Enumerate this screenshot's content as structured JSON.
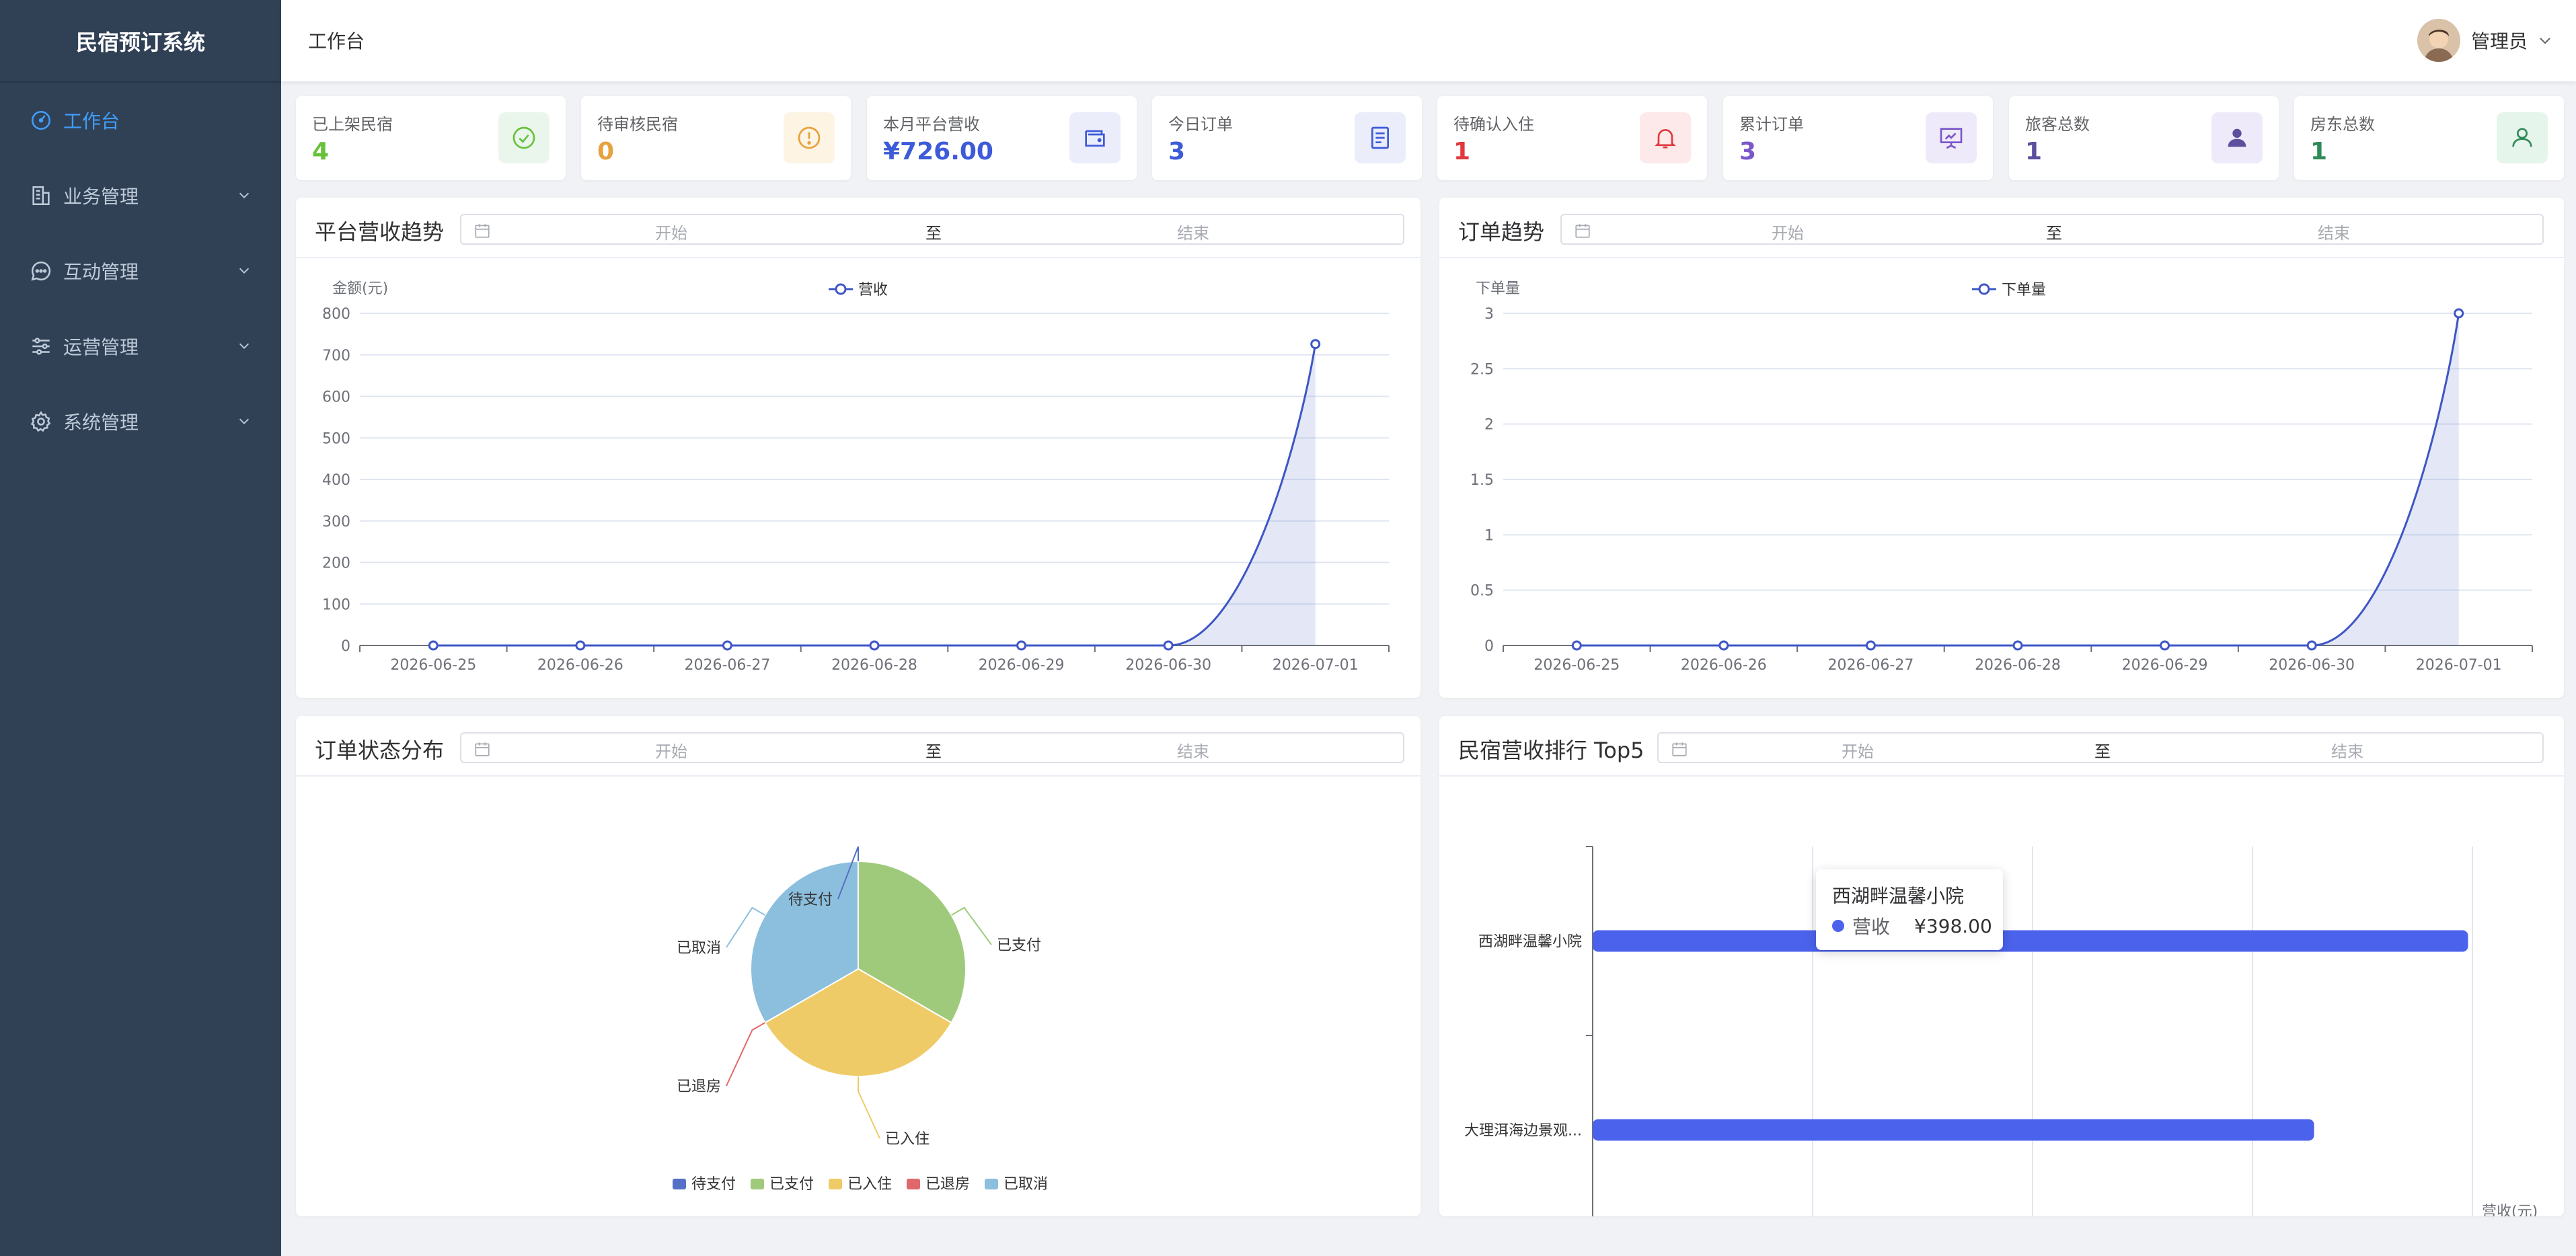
{
  "app": {
    "title": "民宿预订系统"
  },
  "sidebar": {
    "items": [
      {
        "label": "工作台",
        "icon": "dashboard-icon",
        "active": true,
        "expandable": false
      },
      {
        "label": "业务管理",
        "icon": "building-icon",
        "active": false,
        "expandable": true
      },
      {
        "label": "互动管理",
        "icon": "chat-icon",
        "active": false,
        "expandable": true
      },
      {
        "label": "运营管理",
        "icon": "sliders-icon",
        "active": false,
        "expandable": true
      },
      {
        "label": "系统管理",
        "icon": "gear-icon",
        "active": false,
        "expandable": true
      }
    ]
  },
  "header": {
    "breadcrumb": "工作台",
    "user_name": "管理员"
  },
  "stats": [
    {
      "label": "已上架民宿",
      "value": "4",
      "color": "#67c23a",
      "icon": "check-circle-icon",
      "bg": "#eaf6ec"
    },
    {
      "label": "待审核民宿",
      "value": "0",
      "color": "#e6a23c",
      "icon": "warning-circle-icon",
      "bg": "#fdf4e4"
    },
    {
      "label": "本月平台营收",
      "value": "¥726.00",
      "color": "#3d5ad8",
      "icon": "wallet-icon",
      "bg": "#ebedfb"
    },
    {
      "label": "今日订单",
      "value": "3",
      "color": "#3d5ad8",
      "icon": "document-icon",
      "bg": "#ebedfb"
    },
    {
      "label": "待确认入住",
      "value": "1",
      "color": "#e0393e",
      "icon": "bell-icon",
      "bg": "#fde9e9"
    },
    {
      "label": "累计订单",
      "value": "3",
      "color": "#7b57c9",
      "icon": "presentation-icon",
      "bg": "#efeafa"
    },
    {
      "label": "旅客总数",
      "value": "1",
      "color": "#5b4f9e",
      "icon": "user-icon",
      "bg": "#efeafa"
    },
    {
      "label": "房东总数",
      "value": "1",
      "color": "#2f8a57",
      "icon": "user-outline-icon",
      "bg": "#e6f5ec"
    }
  ],
  "date_range": {
    "start_placeholder": "开始",
    "separator": "至",
    "end_placeholder": "结束"
  },
  "panels": {
    "revenue_trend": {
      "title": "平台营收趋势"
    },
    "order_trend": {
      "title": "订单趋势"
    },
    "order_status": {
      "title": "订单状态分布"
    },
    "top5": {
      "title": "民宿营收排行 Top5"
    }
  },
  "tooltip": {
    "title": "西湖畔温馨小院",
    "series": "营收",
    "value": "¥398.00"
  },
  "chart_data": [
    {
      "type": "area",
      "title": "平台营收趋势",
      "ylabel": "金额(元)",
      "legend": [
        "营收"
      ],
      "x": [
        "2026-06-25",
        "2026-06-26",
        "2026-06-27",
        "2026-06-28",
        "2026-06-29",
        "2026-06-30",
        "2026-07-01"
      ],
      "series": [
        {
          "name": "营收",
          "values": [
            0,
            0,
            0,
            0,
            0,
            0,
            726
          ]
        }
      ],
      "ylim": [
        0,
        800
      ],
      "yticks": [
        0,
        100,
        200,
        300,
        400,
        500,
        600,
        700,
        800
      ],
      "color": "#3e56c6",
      "grid": true,
      "legend_placement": "top"
    },
    {
      "type": "area",
      "title": "订单趋势",
      "ylabel": "下单量",
      "legend": [
        "下单量"
      ],
      "x": [
        "2026-06-25",
        "2026-06-26",
        "2026-06-27",
        "2026-06-28",
        "2026-06-29",
        "2026-06-30",
        "2026-07-01"
      ],
      "series": [
        {
          "name": "下单量",
          "values": [
            0,
            0,
            0,
            0,
            0,
            0,
            3
          ]
        }
      ],
      "ylim": [
        0,
        3
      ],
      "yticks": [
        "0",
        "0.5",
        "1",
        "1.5",
        "2",
        "2.5",
        "3"
      ],
      "color": "#3e56c6",
      "grid": true,
      "legend_placement": "top"
    },
    {
      "type": "pie",
      "title": "订单状态分布",
      "slices": [
        {
          "name": "待支付",
          "value": 0,
          "color": "#5470c6"
        },
        {
          "name": "已支付",
          "value": 1,
          "color": "#9fca7b"
        },
        {
          "name": "已入住",
          "value": 1,
          "color": "#efcb67"
        },
        {
          "name": "已退房",
          "value": 0,
          "color": "#e0686a"
        },
        {
          "name": "已取消",
          "value": 1,
          "color": "#8cbfdd"
        }
      ],
      "legend_placement": "bottom"
    },
    {
      "type": "bar",
      "orientation": "horizontal",
      "title": "民宿营收排行 Top5",
      "xlabel": "营收(元)",
      "categories": [
        "西湖畔温馨小院",
        "大理洱海边景观..."
      ],
      "values": [
        398,
        328
      ],
      "xlim": [
        0,
        400
      ],
      "xticks": [
        0,
        100,
        200,
        300,
        400
      ],
      "color": "#4b62ec",
      "grid": true
    }
  ]
}
